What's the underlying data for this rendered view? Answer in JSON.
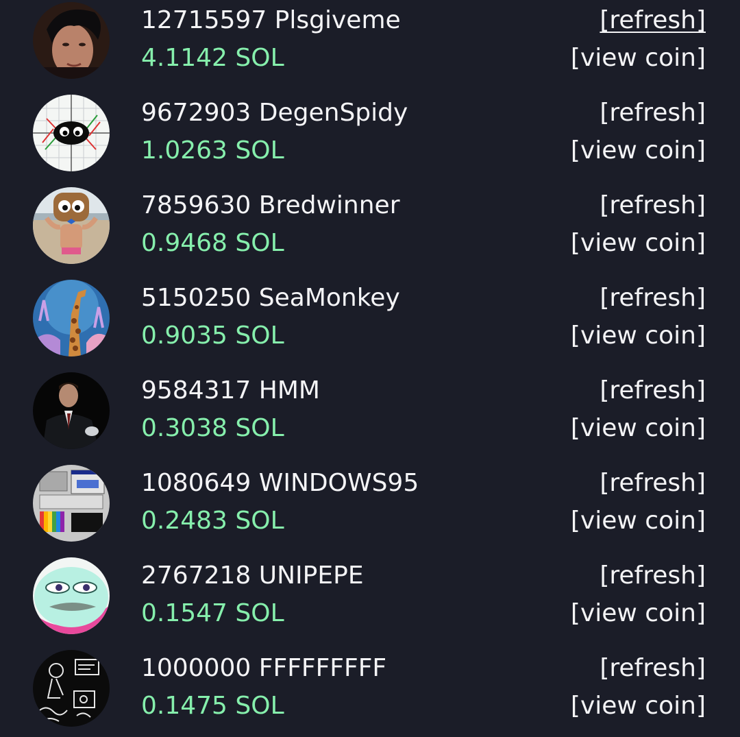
{
  "accent_color": "#86efac",
  "background_color": "#1b1d28",
  "holdings": [
    {
      "name": "12715597 Plsgiveme",
      "amount": "4.1142 SOL",
      "refresh_label": "[refresh]",
      "view_label": "[view coin]",
      "avatar_icon": "portrait-avatar-icon"
    },
    {
      "name": "9672903 DegenSpidy",
      "amount": "1.0263 SOL",
      "refresh_label": "[refresh]",
      "view_label": "[view coin]",
      "avatar_icon": "spider-chart-avatar-icon"
    },
    {
      "name": "7859630 Bredwinner",
      "amount": "0.9468 SOL",
      "refresh_label": "[refresh]",
      "view_label": "[view coin]",
      "avatar_icon": "bread-avatar-icon"
    },
    {
      "name": "5150250 SeaMonkey",
      "amount": "0.9035 SOL",
      "refresh_label": "[refresh]",
      "view_label": "[view coin]",
      "avatar_icon": "sea-giraffe-avatar-icon"
    },
    {
      "name": "9584317 HMM",
      "amount": "0.3038 SOL",
      "refresh_label": "[refresh]",
      "view_label": "[view coin]",
      "avatar_icon": "suited-man-avatar-icon"
    },
    {
      "name": "1080649 WINDOWS95",
      "amount": "0.2483 SOL",
      "refresh_label": "[refresh]",
      "view_label": "[view coin]",
      "avatar_icon": "windows95-avatar-icon"
    },
    {
      "name": "2767218 UNIPEPE",
      "amount": "0.1547 SOL",
      "refresh_label": "[refresh]",
      "view_label": "[view coin]",
      "avatar_icon": "pepe-avatar-icon"
    },
    {
      "name": "1000000 FFFFFFFFF",
      "amount": "0.1475 SOL",
      "refresh_label": "[refresh]",
      "view_label": "[view coin]",
      "avatar_icon": "sketch-avatar-icon"
    }
  ]
}
